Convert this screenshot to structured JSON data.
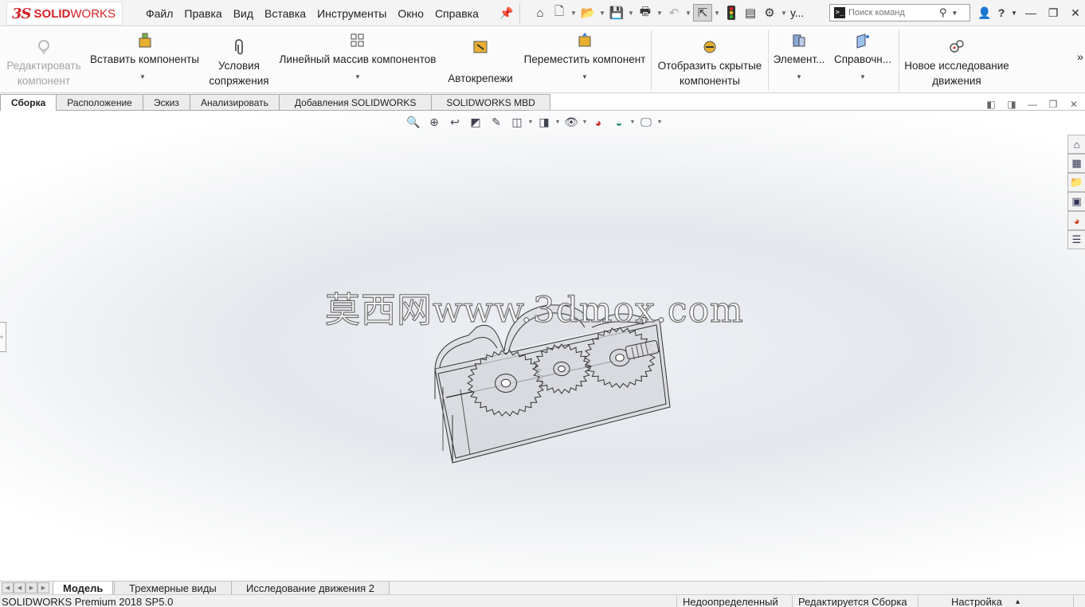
{
  "app": {
    "logo_ds": "3S",
    "logo_text": "SOLID",
    "logo_text2": "WORKS"
  },
  "menu": [
    "Файл",
    "Правка",
    "Вид",
    "Вставка",
    "Инструменты",
    "Окно",
    "Справка"
  ],
  "quick": {
    "user_label": "у..."
  },
  "search": {
    "placeholder": "Поиск команд"
  },
  "ribbon": {
    "edit_component": "Редактировать компонент",
    "insert_components": "Вставить компоненты",
    "mates": "Условия сопряжения",
    "linear_pattern": "Линейный массив компонентов",
    "smart_fasteners": "Автокрепежи",
    "move_component": "Переместить компонент",
    "show_hidden": "Отобразить скрытые компоненты",
    "assembly_features": "Элемент...",
    "reference_geometry": "Справочн...",
    "new_motion_study": "Новое исследование движения",
    "more": "»"
  },
  "tabs": [
    "Сборка",
    "Расположение",
    "Эскиз",
    "Анализировать",
    "Добавления SOLIDWORKS",
    "SOLIDWORKS MBD"
  ],
  "watermark": "莫西网www.3dmox.com",
  "bottom_tabs": [
    "Модель",
    "Трехмерные виды",
    "Исследование движения 2"
  ],
  "status": {
    "product": "SOLIDWORKS Premium 2018 SP5.0",
    "defined": "Недоопределенный",
    "editing": "Редактируется Сборка",
    "customize": "Настройка",
    "customize_arrow": "▴"
  },
  "colors": {
    "brand": "#d31f26",
    "accent": "#2a6fd0"
  }
}
